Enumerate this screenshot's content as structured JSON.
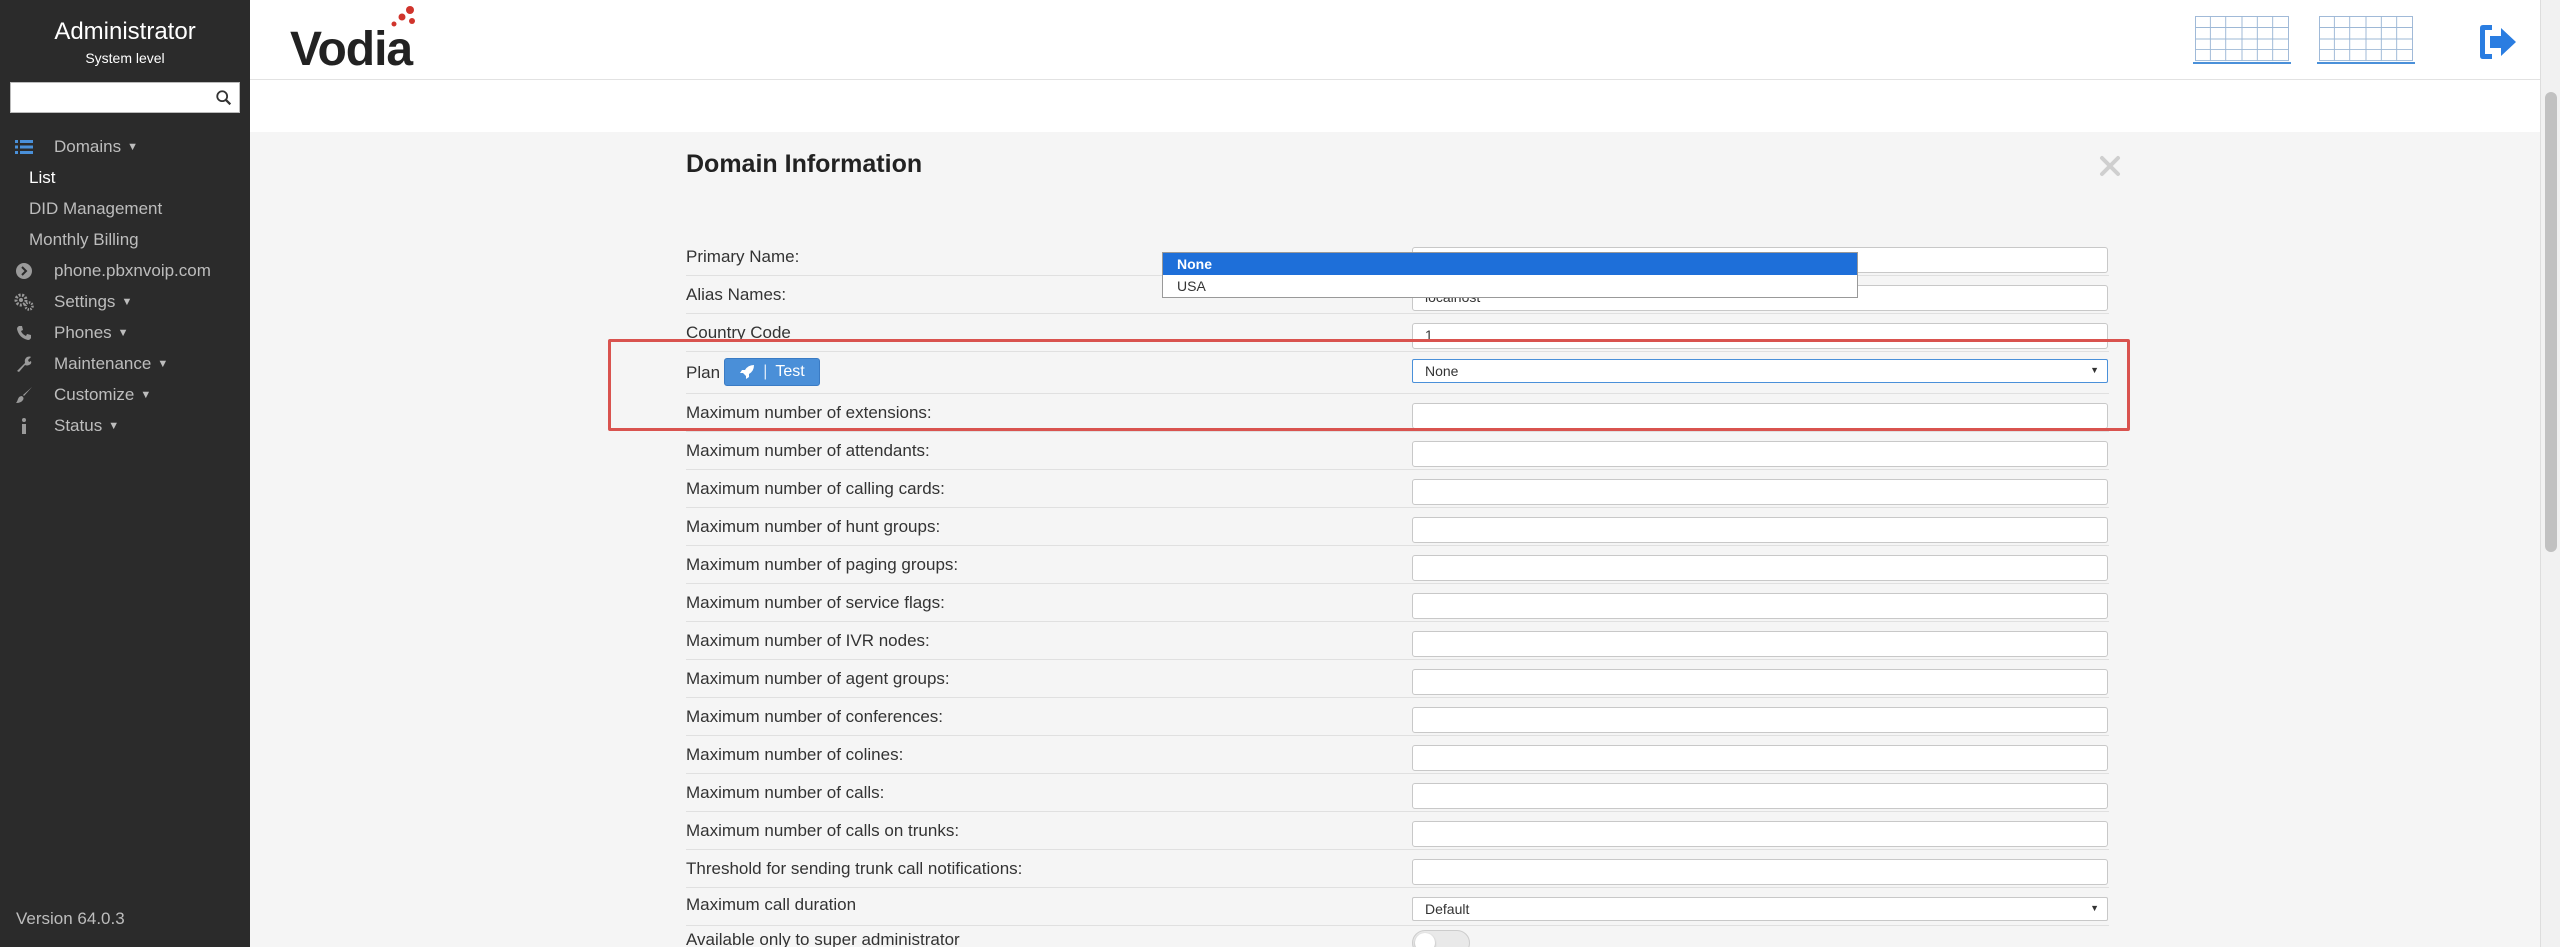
{
  "sidebar": {
    "title": "Administrator",
    "level": "System level",
    "search_placeholder": "",
    "items": [
      {
        "label": "Domains",
        "icon": "list-icon"
      },
      {
        "label": "List"
      },
      {
        "label": "DID Management"
      },
      {
        "label": "Monthly Billing"
      },
      {
        "label": "phone.pbxnvoip.com",
        "icon": "arrow-circle-icon"
      },
      {
        "label": "Settings",
        "icon": "gears-icon"
      },
      {
        "label": "Phones",
        "icon": "phone-icon"
      },
      {
        "label": "Maintenance",
        "icon": "wrench-icon"
      },
      {
        "label": "Customize",
        "icon": "brush-icon"
      },
      {
        "label": "Status",
        "icon": "info-icon"
      }
    ],
    "version": "Version 64.0.3"
  },
  "header": {
    "logo": "Vodia",
    "logo_color": "#d0342c"
  },
  "panel": {
    "title": "Domain Information",
    "rows": {
      "primary_name": {
        "label": "Primary Name:",
        "value": "phone.pbxnvoip.com"
      },
      "alias_names": {
        "label": "Alias Names:",
        "value": "localhost"
      },
      "country_code": {
        "label": "Country Code",
        "value": "1"
      },
      "plan": {
        "label": "Plan",
        "button": "Test",
        "separator": "|",
        "selected": "None",
        "options": [
          "None",
          "USA"
        ]
      },
      "max_extensions": {
        "label": "Maximum number of extensions:"
      },
      "max_attendants": {
        "label": "Maximum number of attendants:"
      },
      "max_calling_cards": {
        "label": "Maximum number of calling cards:"
      },
      "max_hunt_groups": {
        "label": "Maximum number of hunt groups:"
      },
      "max_paging_groups": {
        "label": "Maximum number of paging groups:"
      },
      "max_service_flags": {
        "label": "Maximum number of service flags:"
      },
      "max_ivr_nodes": {
        "label": "Maximum number of IVR nodes:"
      },
      "max_agent_groups": {
        "label": "Maximum number of agent groups:"
      },
      "max_conferences": {
        "label": "Maximum number of conferences:"
      },
      "max_colines": {
        "label": "Maximum number of colines:"
      },
      "max_calls": {
        "label": "Maximum number of calls:"
      },
      "max_calls_trunks": {
        "label": "Maximum number of calls on trunks:"
      },
      "trunk_threshold": {
        "label": "Threshold for sending trunk call notifications:"
      },
      "max_call_duration": {
        "label": "Maximum call duration",
        "value": "Default"
      },
      "super_admin_only": {
        "label": "Available only to super administrator"
      }
    }
  },
  "colors": {
    "accent": "#4a8fd8",
    "highlight": "#d9534f",
    "sidebar_bg": "#2b2b2b"
  }
}
